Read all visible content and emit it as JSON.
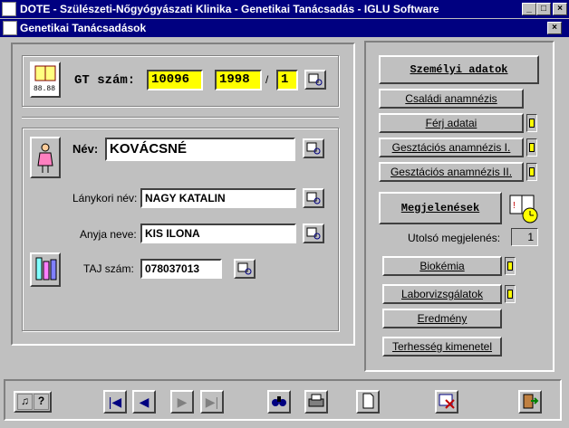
{
  "window": {
    "title": "DOTE - Szülészeti-Nőgyógyászati Klinika - Genetikai Tanácsadás - IGLU Software",
    "min_glyph": "_",
    "max_glyph": "□",
    "close_glyph": "×"
  },
  "child": {
    "title": "Genetikai Tanácsadások",
    "close_glyph": "×"
  },
  "gt": {
    "label": "GT szám:",
    "number": "10096",
    "year": "1998",
    "separator": "/",
    "index": "1",
    "calendar_text": "88.88"
  },
  "person": {
    "name_label": "Név:",
    "name_value": "KOVÁCSNÉ",
    "maiden_label": "Lánykori név:",
    "maiden_value": "NAGY KATALIN",
    "mother_label": "Anyja neve:",
    "mother_value": "KIS ILONA",
    "taj_label": "TAJ szám:",
    "taj_value": "078037013"
  },
  "right": {
    "personal": "Személyi adatok",
    "family": "Családi anamnézis",
    "husband": "Férj adatai",
    "gest1": "Gesztációs anamnézis I.",
    "gest2": "Gesztációs anamnézis II.",
    "visits": "Megjelenések",
    "last_visit_label": "Utolsó megjelenés:",
    "last_visit_value": "1",
    "biochem": "Biokémia",
    "lab": "Laborvizsgálatok",
    "result": "Eredmény",
    "outcome": "Terhesség kimenetel"
  },
  "toolbar": {
    "music_glyph": "♫",
    "help_glyph": "?",
    "first_glyph": "|◀",
    "prev_glyph": "◀",
    "next_glyph": "▶",
    "last_glyph": "▶|"
  },
  "colors": {
    "titlebar": "#000080",
    "highlight": "#ffff00",
    "face": "#c0c0c0"
  }
}
